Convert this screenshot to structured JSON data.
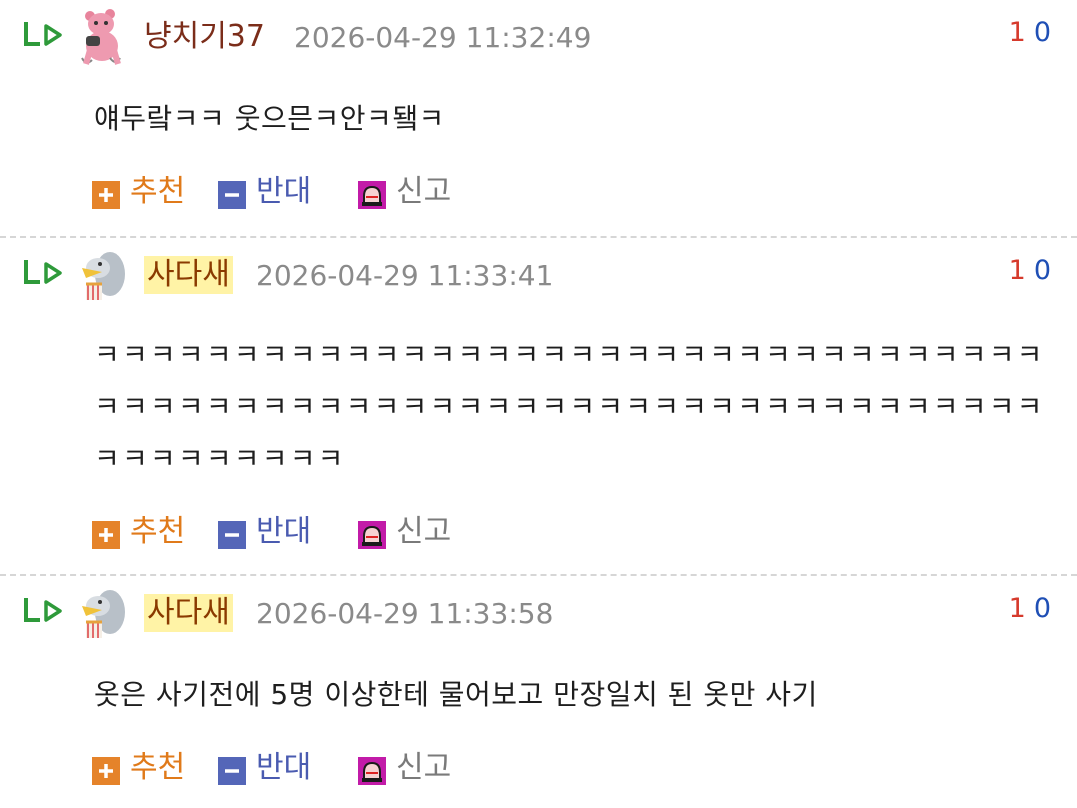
{
  "comments": [
    {
      "nickname": "냥치기37",
      "datetime": "2026-04-29 11:32:49",
      "upvotes": "1",
      "downvotes": "0",
      "text": "얘두랔ㅋㅋ 웃으믄ㅋ안ㅋ됔ㅋ"
    },
    {
      "nickname": "사다새",
      "datetime": "2026-04-29 11:33:41",
      "upvotes": "1",
      "downvotes": "0",
      "text": "ㅋㅋㅋㅋㅋㅋㅋㅋㅋㅋㅋㅋㅋㅋㅋㅋㅋㅋㅋㅋㅋㅋㅋㅋㅋㅋㅋㅋㅋㅋㅋㅋㅋㅋㅋㅋㅋㅋㅋㅋㅋㅋㅋㅋㅋㅋㅋㅋㅋㅋㅋㅋㅋㅋㅋㅋㅋㅋㅋㅋㅋㅋㅋㅋㅋㅋㅋㅋㅋㅋㅋㅋㅋㅋㅋㅋㅋ"
    },
    {
      "nickname": "사다새",
      "datetime": "2026-04-29 11:33:58",
      "upvotes": "1",
      "downvotes": "0",
      "text": "옷은 사기전에 5명 이상한테 물어보고 만장일치 된 옷만 사기"
    }
  ],
  "actions": {
    "recommend": "추천",
    "oppose": "반대",
    "report": "신고"
  },
  "icons": {
    "reply": "reply-arrow-icon",
    "recommend": "plus-icon",
    "oppose": "minus-icon",
    "report": "siren-icon"
  },
  "colors": {
    "upvote": "#d63a2c",
    "downvote": "#1f4fb5",
    "recommend": "#e07a1a",
    "oppose": "#4a5bb0",
    "report": "#7a7a7a",
    "reply_icon": "#2e9a3a",
    "nickname_highlight": "#fff3a6"
  }
}
